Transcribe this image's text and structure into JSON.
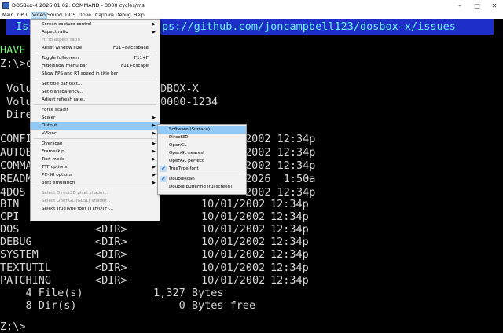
{
  "window": {
    "title": "DOSBox-X 2026.01.02: COMMAND - 3000 cycles/ms",
    "minimize": "–",
    "maximize": "□",
    "close": "✕"
  },
  "menubar": [
    "Main",
    "CPU",
    "Video",
    "Sound",
    "DOS",
    "Drive",
    "Capture",
    "Debug",
    "Help"
  ],
  "terminal": {
    "banner_left": "Iss",
    "banner_right": "ps://github.com/joncampbell123/dosbox-x/issues",
    "have": "HAVE",
    "prompt_partial": "Z:\\>c",
    "vol_line1_left": " Volu",
    "vol_line1_right": "DBOX-X",
    "vol_line2_left": " Volu",
    "vol_line2_right": "0000-1234",
    "dir_line_left": " Dire",
    "files": [
      {
        "name": "CONFI",
        "size": "",
        "date": "",
        "time": "2002 12:34p"
      },
      {
        "name": "AUTOE",
        "size": "",
        "date": "",
        "time": "2002 12:34p"
      },
      {
        "name": "COMMA",
        "size": "",
        "date": "",
        "time": "2002 12:34p"
      },
      {
        "name": "README",
        "size": "",
        "date": "",
        "time": "2026  1:50a"
      },
      {
        "name": "4DOS",
        "size": "",
        "date": "",
        "time": "2002 12:34p"
      }
    ],
    "dirs": [
      {
        "name": "BIN",
        "tag": "",
        "date": "10/01/2002",
        "time": "12:34p"
      },
      {
        "name": "CPI",
        "tag": "",
        "date": "10/01/2002",
        "time": "12:34p"
      },
      {
        "name": "DOS",
        "tag": "<DIR>",
        "date": "10/01/2002",
        "time": "12:34p"
      },
      {
        "name": "DEBUG",
        "tag": "<DIR>",
        "date": "10/01/2002",
        "time": "12:34p"
      },
      {
        "name": "SYSTEM",
        "tag": "<DIR>",
        "date": "10/01/2002",
        "time": "12:34p"
      },
      {
        "name": "TEXTUTIL",
        "tag": "<DIR>",
        "date": "10/01/2002",
        "time": "12:34p"
      },
      {
        "name": "PATCHING",
        "tag": "<DIR>",
        "date": "10/01/2002",
        "time": "12:34p"
      }
    ],
    "summary1": "    4 File(s)           1,327 Bytes",
    "summary2": "    8 Dir(s)                0 Bytes free",
    "prompt": "Z:\\>"
  },
  "video_menu": [
    {
      "label": "Screen capture control",
      "shortcut": "",
      "submenu": true,
      "disabled": false
    },
    {
      "label": "Aspect ratio",
      "shortcut": "",
      "submenu": true,
      "disabled": false
    },
    {
      "label": "Fit to aspect ratio",
      "shortcut": "",
      "submenu": false,
      "disabled": true
    },
    {
      "label": "Reset window size",
      "shortcut": "F11+Backspace",
      "submenu": false,
      "disabled": false
    },
    {
      "sep": true
    },
    {
      "label": "Toggle fullscreen",
      "shortcut": "F11+F",
      "submenu": false,
      "disabled": false
    },
    {
      "label": "Hide/show menu bar",
      "shortcut": "F11+Escape",
      "submenu": false,
      "disabled": false
    },
    {
      "label": "Show FPS and RT speed in title bar",
      "shortcut": "",
      "submenu": false,
      "disabled": false
    },
    {
      "sep": true
    },
    {
      "label": "Set title bar text...",
      "shortcut": "",
      "submenu": false,
      "disabled": false
    },
    {
      "label": "Set transparency...",
      "shortcut": "",
      "submenu": false,
      "disabled": false
    },
    {
      "label": "Adjust refresh rate...",
      "shortcut": "",
      "submenu": false,
      "disabled": false
    },
    {
      "sep": true
    },
    {
      "label": "Force scaler",
      "shortcut": "",
      "submenu": false,
      "disabled": false
    },
    {
      "label": "Scaler",
      "shortcut": "",
      "submenu": true,
      "disabled": false
    },
    {
      "label": "Output",
      "shortcut": "",
      "submenu": true,
      "disabled": false,
      "highlight": true
    },
    {
      "label": "V-Sync",
      "shortcut": "",
      "submenu": true,
      "disabled": false
    },
    {
      "sep": true
    },
    {
      "label": "Overscan",
      "shortcut": "",
      "submenu": true,
      "disabled": false
    },
    {
      "label": "Frameskip",
      "shortcut": "",
      "submenu": true,
      "disabled": false
    },
    {
      "label": "Text-mode",
      "shortcut": "",
      "submenu": true,
      "disabled": false
    },
    {
      "label": "TTF options",
      "shortcut": "",
      "submenu": true,
      "disabled": false
    },
    {
      "label": "PC-98 options",
      "shortcut": "",
      "submenu": true,
      "disabled": false
    },
    {
      "label": "3dfx emulation",
      "shortcut": "",
      "submenu": true,
      "disabled": false
    },
    {
      "sep": true
    },
    {
      "label": "Select Direct3D pixel shader...",
      "shortcut": "",
      "submenu": false,
      "disabled": true
    },
    {
      "label": "Select OpenGL (GLSL) shader...",
      "shortcut": "",
      "submenu": false,
      "disabled": true
    },
    {
      "label": "Select TrueType font (TTF/OTF)...",
      "shortcut": "",
      "submenu": false,
      "disabled": false
    }
  ],
  "output_menu": [
    {
      "label": "Software (Surface)",
      "checked": false,
      "highlight": true
    },
    {
      "label": "Direct3D",
      "checked": false
    },
    {
      "label": "OpenGL",
      "checked": false
    },
    {
      "label": "OpenGL nearest",
      "checked": false
    },
    {
      "label": "OpenGL perfect",
      "checked": false
    },
    {
      "label": "TrueType font",
      "checked": true
    },
    {
      "sep": true
    },
    {
      "label": "Doublescan",
      "checked": true
    },
    {
      "label": "Double buffering (fullscreen)",
      "checked": false
    }
  ],
  "icons": {
    "app": "dosbox-app-icon",
    "check": "✔",
    "arrow": "▶"
  }
}
